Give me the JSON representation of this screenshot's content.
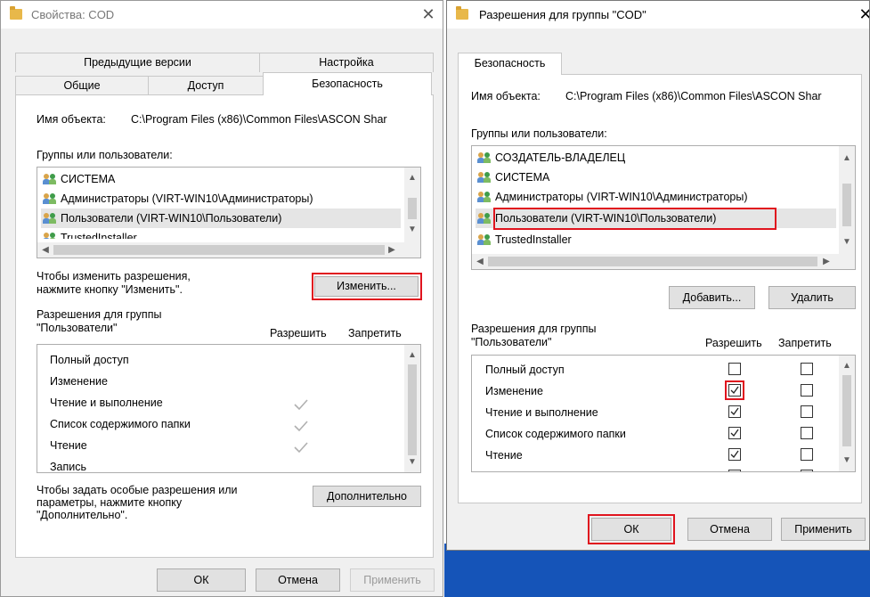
{
  "left_dialog": {
    "title": "Свойства: COD",
    "close_glyph": "✕",
    "tabs_top": [
      "Предыдущие версии",
      "Настройка"
    ],
    "tabs_bottom": [
      "Общие",
      "Доступ",
      "Безопасность"
    ],
    "object_name_label": "Имя объекта:",
    "object_name_value": "C:\\Program Files (x86)\\Common Files\\ASCON Shar",
    "groups_label": "Группы или пользователи:",
    "groups": [
      {
        "name": "СИСТЕМА",
        "selected": false
      },
      {
        "name": "Администраторы (VIRT-WIN10\\Администраторы)",
        "selected": false
      },
      {
        "name": "Пользователи (VIRT-WIN10\\Пользователи)",
        "selected": true
      },
      {
        "name": "TrustedInstaller",
        "selected": false
      }
    ],
    "change_hint": "Чтобы изменить разрешения,\nнажмите кнопку \"Изменить\".",
    "change_button": "Изменить...",
    "perms_label_1": "Разрешения для группы",
    "perms_label_2": "\"Пользователи\"",
    "col_allow": "Разрешить",
    "col_deny": "Запретить",
    "permissions": [
      {
        "name": "Полный доступ",
        "allow": false
      },
      {
        "name": "Изменение",
        "allow": false
      },
      {
        "name": "Чтение и выполнение",
        "allow": true
      },
      {
        "name": "Список содержимого папки",
        "allow": true
      },
      {
        "name": "Чтение",
        "allow": true
      },
      {
        "name": "Запись",
        "allow": false
      }
    ],
    "advanced_hint": "Чтобы задать особые разрешения или\nпараметры, нажмите кнопку\n\"Дополнительно\".",
    "advanced_button": "Дополнительно",
    "ok": "ОК",
    "cancel": "Отмена",
    "apply": "Применить"
  },
  "right_dialog": {
    "title": "Разрешения для группы \"COD\"",
    "close_glyph": "✕",
    "tab": "Безопасность",
    "object_name_label": "Имя объекта:",
    "object_name_value": "C:\\Program Files (x86)\\Common Files\\ASCON Shar",
    "groups_label": "Группы или пользователи:",
    "groups": [
      {
        "name": "СОЗДАТЕЛЬ-ВЛАДЕЛЕЦ",
        "selected": false
      },
      {
        "name": "СИСТЕМА",
        "selected": false
      },
      {
        "name": "Администраторы (VIRT-WIN10\\Администраторы)",
        "selected": false
      },
      {
        "name": "Пользователи (VIRT-WIN10\\Пользователи)",
        "selected": true
      },
      {
        "name": "TrustedInstaller",
        "selected": false
      }
    ],
    "add_button": "Добавить...",
    "remove_button": "Удалить",
    "perms_label_1": "Разрешения для группы",
    "perms_label_2": "\"Пользователи\"",
    "col_allow": "Разрешить",
    "col_deny": "Запретить",
    "permissions": [
      {
        "name": "Полный доступ",
        "allow": false,
        "deny": false
      },
      {
        "name": "Изменение",
        "allow": true,
        "deny": false
      },
      {
        "name": "Чтение и выполнение",
        "allow": true,
        "deny": false
      },
      {
        "name": "Список содержимого папки",
        "allow": true,
        "deny": false
      },
      {
        "name": "Чтение",
        "allow": true,
        "deny": false
      }
    ],
    "ok": "ОК",
    "cancel": "Отмена",
    "apply": "Применить"
  },
  "colors": {
    "highlight": "#e0141e",
    "desktop": "#1554b8"
  }
}
